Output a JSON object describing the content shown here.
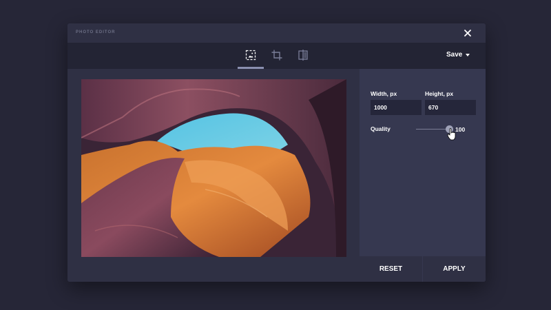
{
  "dialog": {
    "title": "PHOTO EDITOR"
  },
  "toolbar": {
    "tools": [
      {
        "name": "resize-tool",
        "active": true
      },
      {
        "name": "crop-tool",
        "active": false
      },
      {
        "name": "flip-tool",
        "active": false
      }
    ],
    "save_label": "Save"
  },
  "panel": {
    "width_label": "Width, px",
    "width_value": "1000",
    "height_label": "Height, px",
    "height_value": "670",
    "quality_label": "Quality",
    "quality_value": "100"
  },
  "footer": {
    "reset_label": "RESET",
    "apply_label": "APPLY"
  },
  "colors": {
    "background": "#262637",
    "dialog": "#2f3044",
    "toolbar": "#232434",
    "panel": "#363850",
    "input": "#25263a",
    "accent": "#8a8fb0"
  }
}
